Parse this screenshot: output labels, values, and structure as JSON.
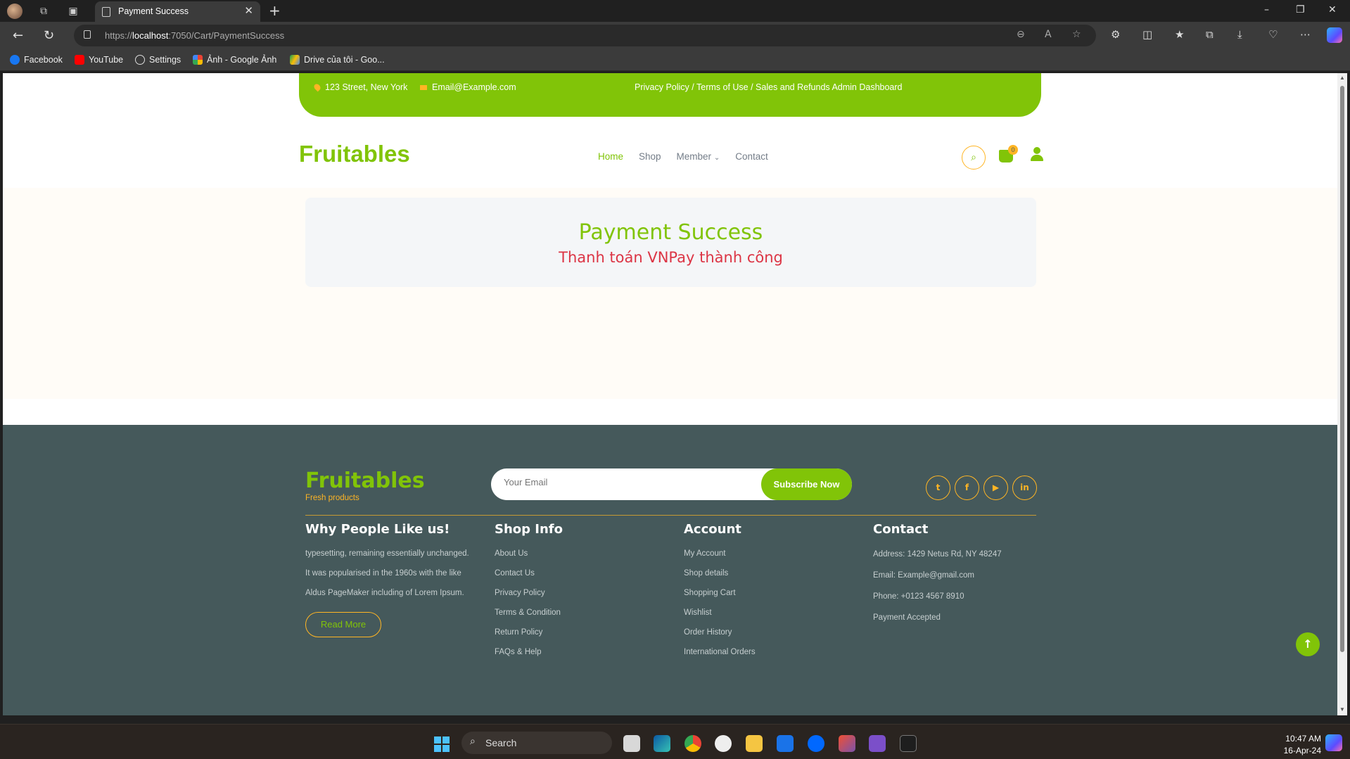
{
  "browser": {
    "tab_title": "Payment Success",
    "url_prefix": "https://",
    "url_host": "localhost",
    "url_rest": ":7050/Cart/PaymentSuccess",
    "bookmarks": [
      "Facebook",
      "YouTube",
      "Settings",
      "Ảnh - Google Ảnh",
      "Drive của tôi - Goo..."
    ]
  },
  "topbar": {
    "address": "123 Street, New York",
    "email": "Email@Example.com",
    "links": "Privacy Policy  /  Terms of Use  /  Sales and Refunds  Admin Dashboard"
  },
  "header": {
    "brand": "Fruitables",
    "nav": [
      "Home",
      "Shop",
      "Member",
      "Contact"
    ],
    "cart_count": "0"
  },
  "main": {
    "title": "Payment Success",
    "message": "Thanh toán VNPay thành công"
  },
  "footer": {
    "brand": "Fruitables",
    "tagline": "Fresh products",
    "email_placeholder": "Your Email",
    "subscribe_label": "Subscribe Now",
    "why": {
      "heading": "Why People Like us!",
      "text": "typesetting, remaining essentially unchanged. It was popularised in the 1960s with the like Aldus PageMaker including of Lorem Ipsum.",
      "button": "Read More"
    },
    "shop_info": {
      "heading": "Shop Info",
      "links": [
        "About Us",
        "Contact Us",
        "Privacy Policy",
        "Terms & Condition",
        "Return Policy",
        "FAQs & Help"
      ]
    },
    "account": {
      "heading": "Account",
      "links": [
        "My Account",
        "Shop details",
        "Shopping Cart",
        "Wishlist",
        "Order History",
        "International Orders"
      ]
    },
    "contact": {
      "heading": "Contact",
      "lines": [
        "Address: 1429 Netus Rd, NY 48247",
        "Email: Example@gmail.com",
        "Phone: +0123 4567 8910",
        "Payment Accepted"
      ]
    }
  },
  "taskbar": {
    "search_label": "Search",
    "time": "10:47 AM",
    "date": "16-Apr-24"
  },
  "colors": {
    "primary": "#81c408",
    "secondary": "#ffb524",
    "footer_bg": "#45595b",
    "message": "#dc3545"
  }
}
